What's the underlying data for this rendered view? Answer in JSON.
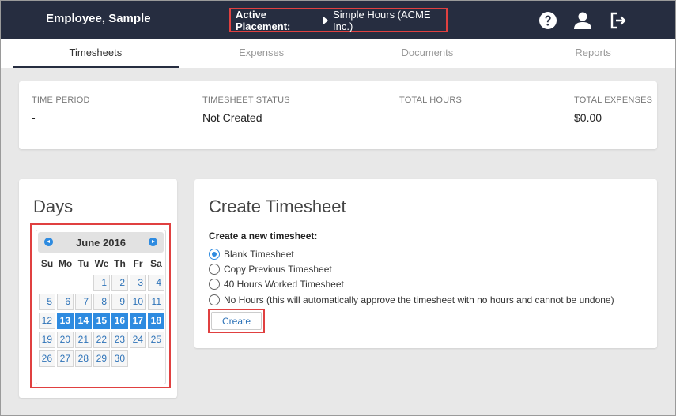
{
  "header": {
    "user_name": "Employee, Sample",
    "placement_label": "Active Placement:",
    "placement_value": "Simple Hours (ACME Inc.)",
    "icons": [
      "help-icon",
      "user-icon",
      "logout-icon"
    ]
  },
  "tabs": [
    {
      "label": "Timesheets",
      "active": true
    },
    {
      "label": "Expenses",
      "active": false
    },
    {
      "label": "Documents",
      "active": false
    },
    {
      "label": "Reports",
      "active": false
    }
  ],
  "summary": {
    "time_period_label": "TIME PERIOD",
    "time_period_value": "-",
    "status_label": "TIMESHEET STATUS",
    "status_value": "Not Created",
    "total_hours_label": "TOTAL HOURS",
    "total_hours_value": "",
    "total_expenses_label": "TOTAL EXPENSES",
    "total_expenses_value": "$0.00"
  },
  "days": {
    "title": "Days",
    "month_label": "June 2016",
    "weekdays": [
      "Su",
      "Mo",
      "Tu",
      "We",
      "Th",
      "Fr",
      "Sa"
    ],
    "first_weekday_index": 3,
    "days_in_month": 30,
    "selected_days": [
      13,
      14,
      15,
      16,
      17,
      18
    ]
  },
  "create": {
    "title": "Create Timesheet",
    "subtitle": "Create a new timesheet:",
    "options": [
      {
        "label": "Blank Timesheet",
        "checked": true
      },
      {
        "label": "Copy Previous Timesheet",
        "checked": false
      },
      {
        "label": "40 Hours Worked Timesheet",
        "checked": false
      },
      {
        "label": "No Hours (this will automatically approve the timesheet with no hours and cannot be undone)",
        "checked": false
      }
    ],
    "button_label": "Create"
  },
  "colors": {
    "header_bg": "#262d40",
    "accent": "#2e8be0",
    "highlight": "#e04040"
  }
}
